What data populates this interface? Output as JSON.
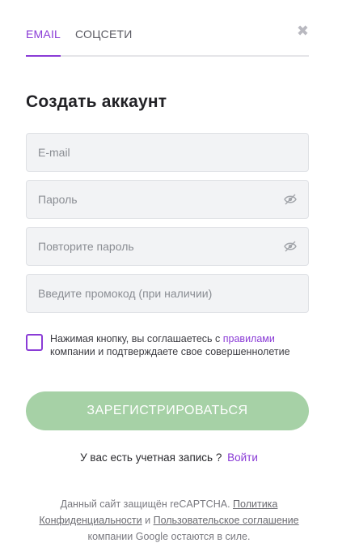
{
  "tabs": {
    "email_label": "EMAIL",
    "social_label": "СОЦСЕТИ",
    "close_icon": "close-icon"
  },
  "title": "Создать аккаунт",
  "fields": {
    "email_placeholder": "E-mail",
    "password_placeholder": "Пароль",
    "repeat_password_placeholder": "Повторите пароль",
    "promo_placeholder": "Введите промокод (при наличии)"
  },
  "consent": {
    "text_before": "Нажимая кнопку, вы соглашаетесь с ",
    "rules_link": "правилами",
    "text_after": " компании и подтверждаете свое совершеннолетие"
  },
  "register_button": "ЗАРЕГИСТРИРОВАТЬСЯ",
  "login": {
    "prompt": "У вас есть учетная запись ?",
    "link": "Войти"
  },
  "recaptcha": {
    "text1": "Данный сайт защищён reCAPTCHA. ",
    "privacy_link": "Политика Конфиденциальности",
    "and": " и ",
    "terms_link": "Пользовательское соглашение",
    "text2": " компании Google остаются в силе."
  },
  "colors": {
    "accent": "#8a3bd6",
    "button_bg": "#a6d1a6",
    "field_bg": "#f2f3f5"
  }
}
